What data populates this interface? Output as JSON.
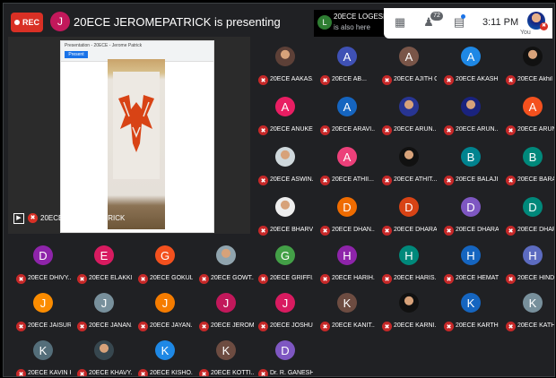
{
  "rec": {
    "label": "REC"
  },
  "presenter": {
    "initial": "J",
    "banner": "20ECE JEROMEPATRICK is presenting",
    "tile_label": "20ECE JEROMEPATRICK"
  },
  "also_here": {
    "initial": "L",
    "name": "20ECE LOGESH...",
    "subtitle": "is also here"
  },
  "toolbar": {
    "time": "3:11 PM",
    "people_count": "72",
    "you_label": "You"
  },
  "slide": {
    "doc_title": "Presentation - 20ECE - Jerome Patrick",
    "tab": "Present"
  },
  "colors": {
    "rec": "#d93025",
    "mic_off": "#c62828",
    "background": "#202124"
  },
  "tiles": [
    {
      "initial": "",
      "label": "20ECE AAKAS...",
      "color": "#5d4037",
      "photo": true
    },
    {
      "initial": "A",
      "label": "20ECE AB...",
      "color": "#3f51b5"
    },
    {
      "initial": "A",
      "label": "20ECE AJITH G.",
      "color": "#795548"
    },
    {
      "initial": "A",
      "label": "20ECE AKASH...",
      "color": "#1e88e5"
    },
    {
      "initial": "",
      "label": "20ECE Akhil",
      "color": "#111111",
      "photo": true
    },
    {
      "initial": "A",
      "label": "20ECE ANUKE...",
      "color": "#e91e63"
    },
    {
      "initial": "A",
      "label": "20ECE ARAVI...",
      "color": "#1565c0"
    },
    {
      "initial": "",
      "label": "20ECE ARUN...",
      "color": "#283593",
      "photo": true
    },
    {
      "initial": "",
      "label": "20ECE ARUN...",
      "color": "#1a237e",
      "photo": true
    },
    {
      "initial": "A",
      "label": "20ECE ARUNA...",
      "color": "#f4511e"
    },
    {
      "initial": "",
      "label": "20ECE ASWIN...",
      "color": "#cfd8dc",
      "photo": true
    },
    {
      "initial": "A",
      "label": "20ECE ATHII...",
      "color": "#ec407a"
    },
    {
      "initial": "",
      "label": "20ECE ATHIT...",
      "color": "#111111",
      "photo": true
    },
    {
      "initial": "B",
      "label": "20ECE BALAJI...",
      "color": "#00838f"
    },
    {
      "initial": "B",
      "label": "20ECE BARAT...",
      "color": "#00897b"
    },
    {
      "initial": "",
      "label": "20ECE BHARV...",
      "color": "#eeeeee",
      "photo": true
    },
    {
      "initial": "D",
      "label": "20ECE DHAN...",
      "color": "#ef6c00"
    },
    {
      "initial": "D",
      "label": "20ECE DHARA...",
      "color": "#d84315"
    },
    {
      "initial": "D",
      "label": "20ECE DHARA...",
      "color": "#7e57c2"
    },
    {
      "initial": "D",
      "label": "20ECE DHARA...",
      "color": "#00897b"
    },
    {
      "initial": "D",
      "label": "20ECE DHIVY...",
      "color": "#8e24aa"
    },
    {
      "initial": "E",
      "label": "20ECE ELAKKI...",
      "color": "#d81b60"
    },
    {
      "initial": "G",
      "label": "20ECE GOKUL...",
      "color": "#f4511e"
    },
    {
      "initial": "",
      "label": "20ECE GOWT...",
      "color": "#90a4ae",
      "photo": true
    },
    {
      "initial": "G",
      "label": "20ECE GRIFFI...",
      "color": "#43a047"
    },
    {
      "initial": "H",
      "label": "20ECE HARIH...",
      "color": "#8e24aa"
    },
    {
      "initial": "H",
      "label": "20ECE HARIS...",
      "color": "#00897b"
    },
    {
      "initial": "H",
      "label": "20ECE HEMAT...",
      "color": "#1565c0"
    },
    {
      "initial": "H",
      "label": "20ECE HINDU...",
      "color": "#5c6bc0"
    },
    {
      "initial": "J",
      "label": "20ECE JAISUR...",
      "color": "#fb8c00"
    },
    {
      "initial": "J",
      "label": "20ECE JANAN...",
      "color": "#78909c"
    },
    {
      "initial": "J",
      "label": "20ECE JAYAN...",
      "color": "#f57c00"
    },
    {
      "initial": "J",
      "label": "20ECE JEROM...",
      "color": "#c2185b"
    },
    {
      "initial": "J",
      "label": "20ECE JOSHU...",
      "color": "#d81b60"
    },
    {
      "initial": "K",
      "label": "20ECE KANIT...",
      "color": "#6d4c41"
    },
    {
      "initial": "",
      "label": "20ECE KARNI...",
      "color": "#111111",
      "photo": true
    },
    {
      "initial": "K",
      "label": "20ECE KARTH...",
      "color": "#1565c0"
    },
    {
      "initial": "K",
      "label": "20ECE KATHI...",
      "color": "#78909c"
    },
    {
      "initial": "K",
      "label": "20ECE KAVIN K.",
      "color": "#546e7a"
    },
    {
      "initial": "",
      "label": "20ECE KHAVY...",
      "color": "#37474f",
      "photo": true
    },
    {
      "initial": "K",
      "label": "20ECE KISHO...",
      "color": "#1e88e5"
    },
    {
      "initial": "K",
      "label": "20ECE KOTTI...",
      "color": "#6d4c41"
    },
    {
      "initial": "D",
      "label": "Dr. R. GANESH...",
      "color": "#7e57c2"
    }
  ]
}
